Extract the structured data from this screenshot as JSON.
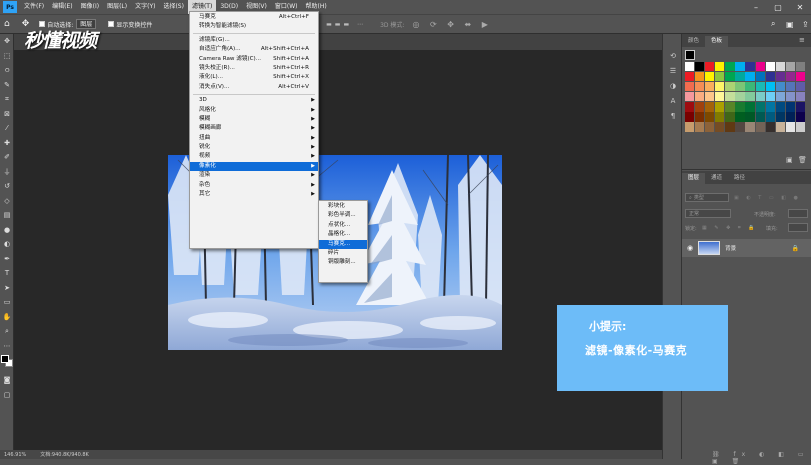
{
  "app": {
    "logo": "Ps",
    "watermark": "秒懂视频"
  },
  "menubar": {
    "items": [
      "文件(F)",
      "编辑(E)",
      "图像(I)",
      "图层(L)",
      "文字(Y)",
      "选择(S)",
      "滤镜(T)",
      "3D(D)",
      "视图(V)",
      "窗口(W)",
      "帮助(H)"
    ],
    "active": "滤镜(T)"
  },
  "optbar": {
    "auto_select": "自动选择:",
    "auto_select_value": "图层",
    "show_transform": "显示变换控件",
    "mode3d": "3D 模式:"
  },
  "filter_menu": {
    "top": [
      {
        "label": "马赛克",
        "shortcut": "Alt+Ctrl+F"
      },
      {
        "label": "转换为智能滤镜(S)",
        "shortcut": ""
      }
    ],
    "mid": [
      {
        "label": "滤镜库(G)...",
        "shortcut": ""
      },
      {
        "label": "自适应广角(A)...",
        "shortcut": "Alt+Shift+Ctrl+A"
      },
      {
        "label": "Camera Raw 滤镜(C)...",
        "shortcut": "Shift+Ctrl+A"
      },
      {
        "label": "镜头校正(R)...",
        "shortcut": "Shift+Ctrl+R"
      },
      {
        "label": "液化(L)...",
        "shortcut": "Shift+Ctrl+X"
      },
      {
        "label": "消失点(V)...",
        "shortcut": "Alt+Ctrl+V"
      }
    ],
    "sub": [
      "3D",
      "风格化",
      "模糊",
      "模糊画廊",
      "扭曲",
      "锐化",
      "视频",
      "像素化",
      "渲染",
      "杂色",
      "其它"
    ],
    "highlighted": "像素化"
  },
  "pixelate_menu": {
    "items": [
      "彩块化",
      "彩色半调...",
      "点状化...",
      "晶格化...",
      "马赛克...",
      "碎片",
      "铜版雕刻..."
    ],
    "highlighted": "马赛克..."
  },
  "swatches_panel": {
    "tabs": [
      "颜色",
      "色板"
    ],
    "active_tab": "色板",
    "colors": [
      "#ffffff",
      "#000000",
      "#ed1c24",
      "#fff200",
      "#00a651",
      "#00aeef",
      "#2e3192",
      "#ec008c",
      "#ffffff",
      "#d9d9d9",
      "#a6a6a6",
      "#7f7f7f",
      "#ed1c24",
      "#f7941d",
      "#fff200",
      "#8dc63f",
      "#00a651",
      "#00a99d",
      "#00aeef",
      "#0072bc",
      "#2e3192",
      "#662d91",
      "#92278f",
      "#ec008c",
      "#f26c4f",
      "#f68e56",
      "#fbaf5d",
      "#fff568",
      "#acd373",
      "#7cc576",
      "#3bb878",
      "#1abbb4",
      "#00bff3",
      "#438ccb",
      "#5574b9",
      "#605ca8",
      "#f5989d",
      "#f9ad81",
      "#fdc68a",
      "#fff799",
      "#c4df9b",
      "#a3d39c",
      "#82ca9c",
      "#7accc8",
      "#6dcff6",
      "#7ea7d8",
      "#8493ca",
      "#8882be",
      "#9e0b0f",
      "#a0410d",
      "#a36209",
      "#aba000",
      "#598527",
      "#197b30",
      "#007236",
      "#00746b",
      "#0076a3",
      "#004a80",
      "#003471",
      "#1b1464",
      "#790000",
      "#7b2e00",
      "#7d4900",
      "#827b00",
      "#406618",
      "#005e20",
      "#005826",
      "#005952",
      "#005b7f",
      "#003663",
      "#002157",
      "#0d004c",
      "#c69c6d",
      "#a67c52",
      "#8c6239",
      "#754c24",
      "#603913",
      "#534741",
      "#998675",
      "#736357",
      "#362f2d",
      "#c7b299",
      "#e5e5e5",
      "#cccccc"
    ]
  },
  "layers_panel": {
    "tabs": [
      "图层",
      "通道",
      "路径"
    ],
    "active_tab": "图层",
    "kind_label": "类型",
    "blend_mode": "正常",
    "opacity_label": "不透明度:",
    "lock_label": "锁定:",
    "fill_label": "填充:",
    "layer_name": "背景"
  },
  "tip": {
    "title": "小提示:",
    "body": "滤镜-像素化-马赛克"
  },
  "status": {
    "zoom": "146.91%",
    "doc": "文档:940.8K/940.8K"
  }
}
